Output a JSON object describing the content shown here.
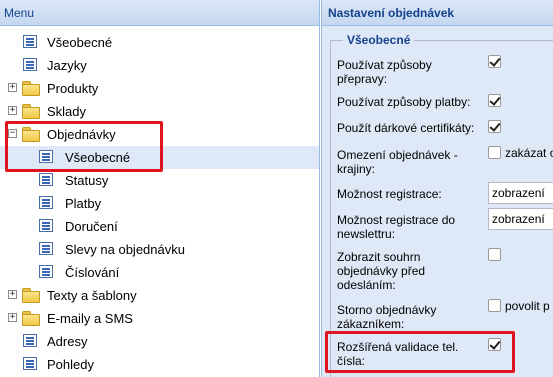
{
  "tree": {
    "header": "Menu",
    "items": [
      {
        "label": "Všeobecné",
        "type": "page",
        "expander": ""
      },
      {
        "label": "Jazyky",
        "type": "page",
        "expander": ""
      },
      {
        "label": "Produkty",
        "type": "folder",
        "expander": "+"
      },
      {
        "label": "Sklady",
        "type": "folder",
        "expander": "+"
      },
      {
        "label": "Objednávky",
        "type": "folder",
        "expander": "−"
      },
      {
        "label": "Všeobecné",
        "type": "page",
        "expander": "",
        "selected": true
      },
      {
        "label": "Statusy",
        "type": "page",
        "expander": ""
      },
      {
        "label": "Platby",
        "type": "page",
        "expander": ""
      },
      {
        "label": "Doručení",
        "type": "page",
        "expander": ""
      },
      {
        "label": "Slevy na objednávku",
        "type": "page",
        "expander": ""
      },
      {
        "label": "Číslování",
        "type": "page",
        "expander": ""
      },
      {
        "label": "Texty a šablony",
        "type": "folder",
        "expander": "+"
      },
      {
        "label": "E-maily a SMS",
        "type": "folder",
        "expander": "+"
      },
      {
        "label": "Adresy",
        "type": "page",
        "expander": ""
      },
      {
        "label": "Pohledy",
        "type": "page",
        "expander": ""
      }
    ]
  },
  "settings": {
    "header": "Nastavení objednávek",
    "section_title": "Všeobecné",
    "fields": [
      {
        "label": "Používat způsoby přepravy:",
        "control": "checkbox",
        "checked": true
      },
      {
        "label": "Používat způsoby platby:",
        "control": "checkbox",
        "checked": true
      },
      {
        "label": "Použít dárkové certifikáty:",
        "control": "checkbox",
        "checked": true
      },
      {
        "label": "Omezení objednávek - krajiny:",
        "control": "checkbox",
        "checked": false,
        "box_label": "zakázat o"
      },
      {
        "label": "Možnost registrace:",
        "control": "combo",
        "value": "zobrazení"
      },
      {
        "label": "Možnost registrace do newslettru:",
        "control": "combo",
        "value": "zobrazení"
      },
      {
        "label": "Zobrazit souhrn objednávky před odesláním:",
        "control": "checkbox",
        "checked": false
      },
      {
        "label": "Storno objednávky zákazníkem:",
        "control": "checkbox",
        "checked": false,
        "box_label": "povolit p"
      },
      {
        "label": "Rozšířená validace tel. čísla:",
        "control": "checkbox",
        "checked": true
      }
    ]
  },
  "colors": {
    "highlight": "#e0141e",
    "header_text": "#15428b",
    "selected_row": "#dfe8f6"
  }
}
